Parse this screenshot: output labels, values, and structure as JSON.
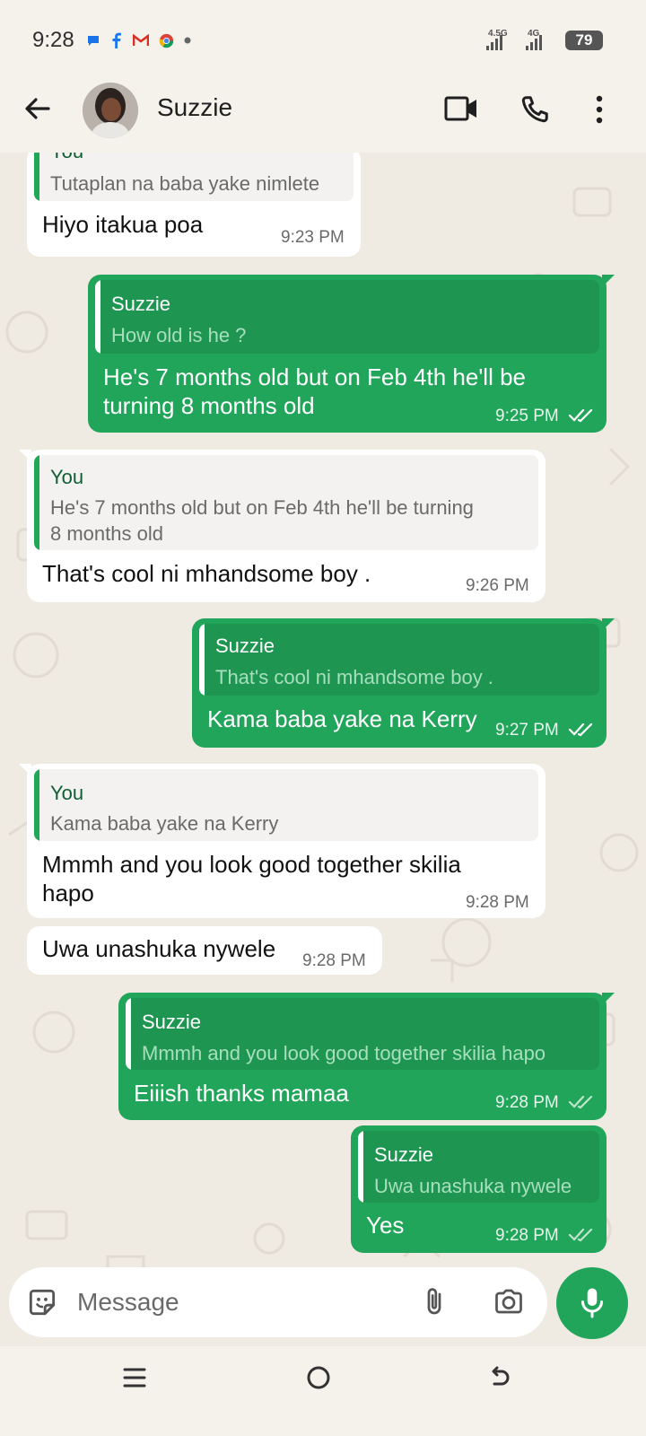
{
  "status_bar": {
    "time": "9:28",
    "notification_icons": [
      "messages-icon",
      "facebook-icon",
      "gmail-icon",
      "chrome-icon",
      "more-dot-icon"
    ],
    "network_1": "4.5G",
    "network_2": "4G",
    "battery": "79"
  },
  "header": {
    "contact_name": "Suzzie",
    "icons": [
      "back-arrow-icon",
      "video-call-icon",
      "phone-call-icon",
      "more-vertical-icon"
    ]
  },
  "messages": [
    {
      "direction": "in",
      "quote_name": "You",
      "quote_text": "Tutaplan na baba yake nimlete",
      "text": "Hiyo itakua poa",
      "time": "9:23 PM"
    },
    {
      "direction": "out",
      "quote_name": "Suzzie",
      "quote_text": "How old is he ?",
      "text_line1": "He's 7 months old but on Feb 4th he'll be",
      "text_line2": "turning 8 months old",
      "time": "9:25 PM",
      "read": true
    },
    {
      "direction": "in",
      "quote_name": "You",
      "quote_line1": "He's 7 months old but on Feb 4th he'll be turning",
      "quote_line2": "8 months old",
      "text": "That's cool ni mhandsome boy .",
      "time": "9:26 PM"
    },
    {
      "direction": "out",
      "quote_name": "Suzzie",
      "quote_text": "That's cool ni mhandsome boy .",
      "text": "Kama baba yake na Kerry",
      "time": "9:27 PM",
      "read": true
    },
    {
      "direction": "in",
      "quote_name": "You",
      "quote_text": "Kama baba yake na Kerry",
      "text_line1": "Mmmh and you look good together skilia",
      "text_line2": "hapo",
      "time": "9:28 PM"
    },
    {
      "direction": "in",
      "text": "Uwa unashuka nywele",
      "time": "9:28 PM"
    },
    {
      "direction": "out",
      "quote_name": "Suzzie",
      "quote_text": "Mmmh and you look good together skilia hapo",
      "text": "Eiiish thanks mamaa",
      "time": "9:28 PM",
      "read": false
    },
    {
      "direction": "out",
      "quote_name": "Suzzie",
      "quote_text": "Uwa unashuka nywele",
      "text": "Yes",
      "time": "9:28 PM",
      "read": false
    }
  ],
  "composer": {
    "placeholder": "Message",
    "icons": [
      "sticker-icon",
      "attach-icon",
      "camera-icon",
      "mic-icon"
    ]
  },
  "colors": {
    "accent_green": "#21a55a",
    "chat_background": "#efeae2",
    "incoming_bubble": "#ffffff",
    "read_ticks": "#ffffff",
    "delivered_ticks": "#bfe5cd"
  }
}
